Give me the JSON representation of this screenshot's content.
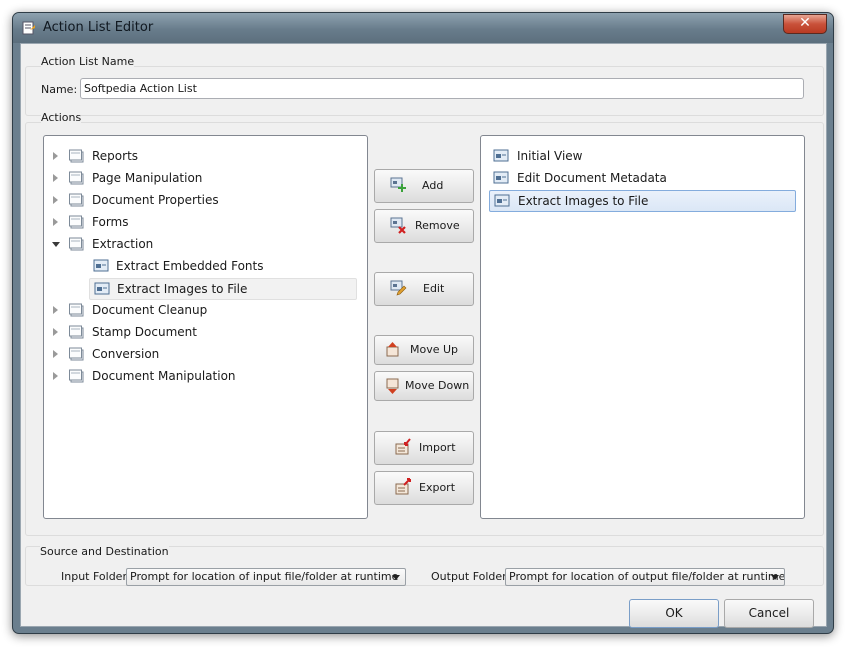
{
  "window": {
    "title": "Action List Editor",
    "close": "✕"
  },
  "name_group": {
    "title": "Action List Name",
    "name_label": "Name:",
    "name_value": "Softpedia Action List"
  },
  "actions_group": {
    "title": "Actions",
    "tree": [
      {
        "label": "Reports",
        "expanded": false
      },
      {
        "label": "Page Manipulation",
        "expanded": false
      },
      {
        "label": "Document Properties",
        "expanded": false
      },
      {
        "label": "Forms",
        "expanded": false
      },
      {
        "label": "Extraction",
        "expanded": true
      },
      {
        "label": "Extract Embedded Fonts",
        "child": true
      },
      {
        "label": "Extract Images to File",
        "child": true,
        "selected": true
      },
      {
        "label": "Document Cleanup",
        "expanded": false
      },
      {
        "label": "Stamp Document",
        "expanded": false
      },
      {
        "label": "Conversion",
        "expanded": false
      },
      {
        "label": "Document Manipulation",
        "expanded": false
      }
    ],
    "buttons": {
      "add": "Add",
      "remove": "Remove",
      "edit": "Edit",
      "move_up": "Move Up",
      "move_down": "Move Down",
      "import": "Import",
      "export": "Export"
    },
    "selected_list": [
      {
        "label": "Initial View"
      },
      {
        "label": "Edit Document Metadata"
      },
      {
        "label": "Extract Images to File",
        "selected": true
      }
    ]
  },
  "source_group": {
    "title": "Source and Destination",
    "input_label": "Input Folder",
    "input_value": "Prompt for location of input file/folder at runtime",
    "output_label": "Output Folder",
    "output_value": "Prompt for location of output file/folder at runtime"
  },
  "footer": {
    "ok": "OK",
    "cancel": "Cancel"
  },
  "colors": {
    "selection_border": "#84acdd",
    "window_frame": "#6b7f8e"
  }
}
